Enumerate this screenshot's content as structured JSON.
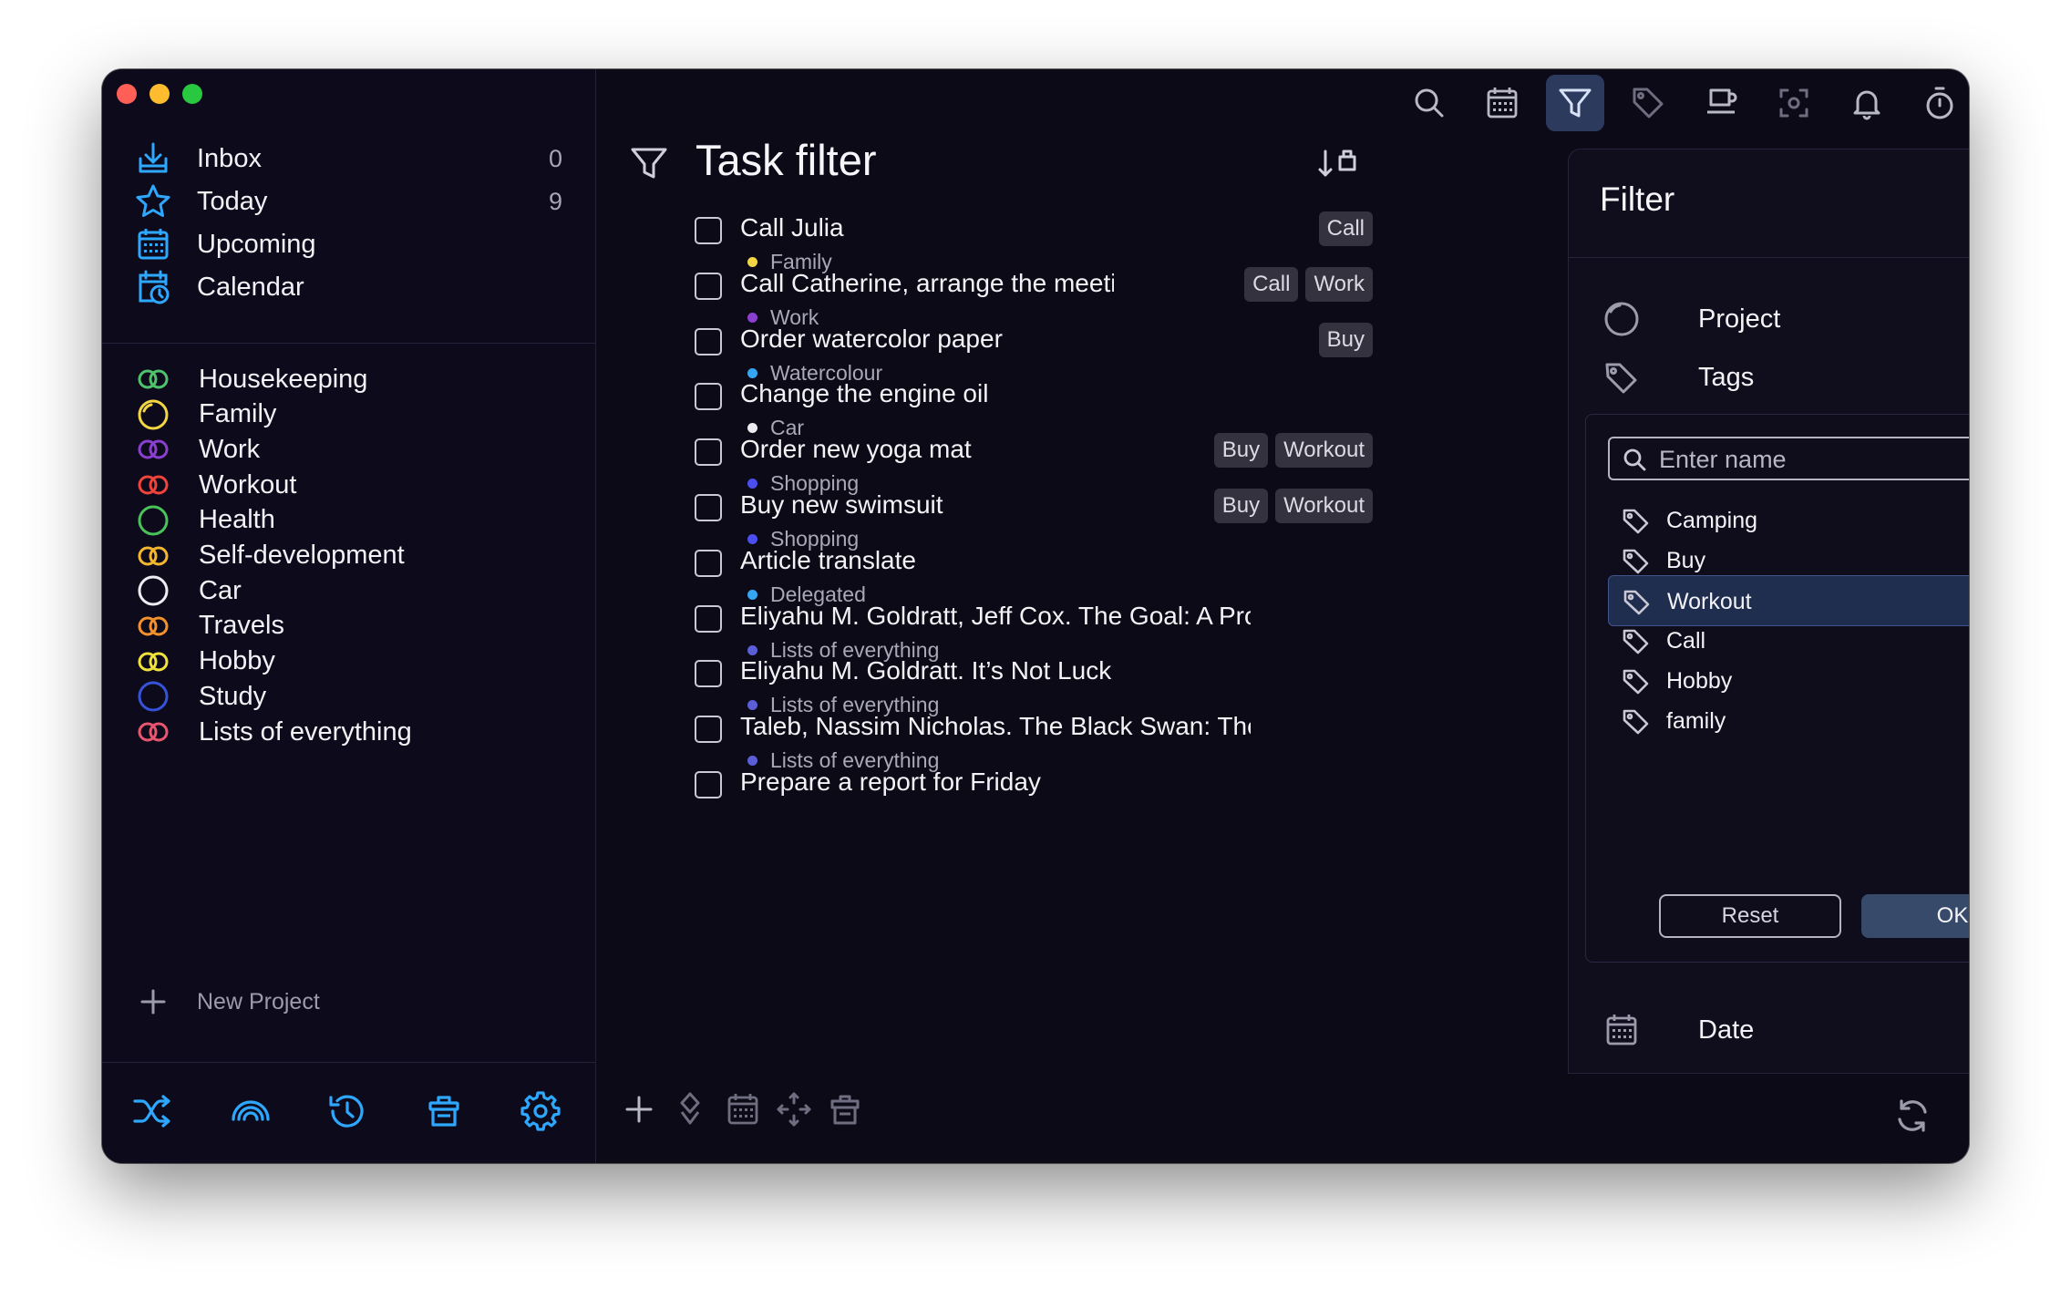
{
  "colors": {
    "accent": "#2ea8ff",
    "window_bg": "#0c0a16",
    "selected_row": "#1f2d4f",
    "ok_button": "#384a6a"
  },
  "sidebar": {
    "nav": [
      {
        "label": "Inbox",
        "count": "0",
        "icon": "inbox-icon"
      },
      {
        "label": "Today",
        "count": "9",
        "icon": "star-icon"
      },
      {
        "label": "Upcoming",
        "count": "",
        "icon": "calendar-grid-icon"
      },
      {
        "label": "Calendar",
        "count": "",
        "icon": "calendar-clock-icon"
      }
    ],
    "projects": [
      {
        "label": "Housekeeping",
        "color": "#4fc36b"
      },
      {
        "label": "Family",
        "color": "#f2d643"
      },
      {
        "label": "Work",
        "color": "#8b3fcf"
      },
      {
        "label": "Workout",
        "color": "#f0443a"
      },
      {
        "label": "Health",
        "color": "#49c25a"
      },
      {
        "label": "Self-development",
        "color": "#f4b62c"
      },
      {
        "label": "Car",
        "color": "#ececf2"
      },
      {
        "label": "Travels",
        "color": "#f5912a"
      },
      {
        "label": "Hobby",
        "color": "#f0e23a"
      },
      {
        "label": "Study",
        "color": "#3552d8"
      },
      {
        "label": "Lists of everything",
        "color": "#e8556e"
      }
    ],
    "new_project": "New Project"
  },
  "main": {
    "title": "Task filter",
    "tasks": [
      {
        "name": "Call Julia",
        "project": "Family",
        "dot": "#f2d643",
        "tags": [
          "Call"
        ]
      },
      {
        "name": "Call Catherine, arrange the meeting",
        "project": "Work",
        "dot": "#8b3fcf",
        "tags": [
          "Call",
          "Work"
        ]
      },
      {
        "name": "Order watercolor paper",
        "project": "Watercolour",
        "dot": "#35a7f2",
        "tags": [
          "Buy"
        ]
      },
      {
        "name": "Change the engine oil",
        "project": "Car",
        "dot": "#ececf2",
        "tags": []
      },
      {
        "name": "Order new yoga mat",
        "project": "Shopping",
        "dot": "#4b4ff0",
        "tags": [
          "Buy",
          "Workout"
        ]
      },
      {
        "name": "Buy new swimsuit",
        "project": "Shopping",
        "dot": "#4b4ff0",
        "tags": [
          "Buy",
          "Workout"
        ]
      },
      {
        "name": "Article translate",
        "project": "Delegated",
        "dot": "#35a7f2",
        "tags": []
      },
      {
        "name": "Eliyahu M. Goldratt, Jeff Cox. The Goal: A Process of Ongoing Improvement",
        "project": "Lists of everything",
        "dot": "#5a5fd8",
        "tags": []
      },
      {
        "name": "Eliyahu M. Goldratt. It’s Not Luck",
        "project": "Lists of everything",
        "dot": "#5a5fd8",
        "tags": []
      },
      {
        "name": "Taleb, Nassim Nicholas. The Black Swan: The Impact of the Highly Improbable",
        "project": "Lists of everything",
        "dot": "#5a5fd8",
        "tags": []
      },
      {
        "name": "Prepare a report for Friday",
        "project": "",
        "dot": "#8b3fcf",
        "tags": []
      }
    ]
  },
  "filter": {
    "title": "Filter",
    "sections": {
      "project": "Project",
      "tags": "Tags",
      "date": "Date"
    },
    "search_placeholder": "Enter name",
    "tag_options": [
      {
        "label": "Camping",
        "checked": false
      },
      {
        "label": "Buy",
        "checked": false
      },
      {
        "label": "Workout",
        "checked": true
      },
      {
        "label": "Call",
        "checked": false
      },
      {
        "label": "Hobby",
        "checked": false
      },
      {
        "label": "family",
        "checked": false
      }
    ],
    "reset_label": "Reset",
    "ok_label": "OK"
  }
}
